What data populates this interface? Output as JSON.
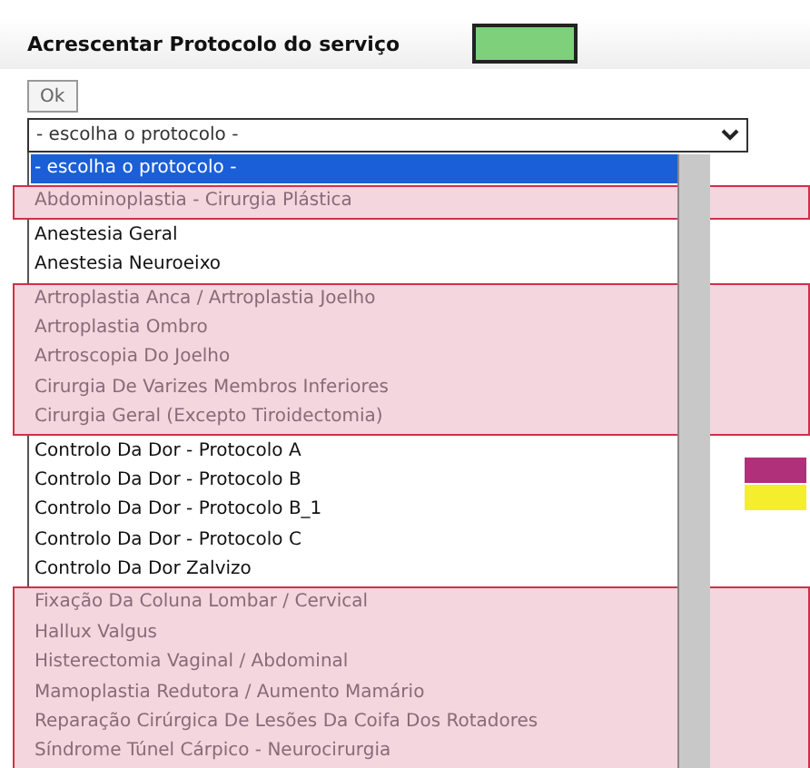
{
  "form": {
    "title": "Acrescentar Protocolo do serviço",
    "ok_button": "Ok",
    "select_value": "- escolha o protocolo -"
  },
  "options_groups": [
    {
      "highlighted": false,
      "options": [
        {
          "label": "- escolha o protocolo -",
          "selected": true
        }
      ]
    },
    {
      "highlighted": true,
      "options": [
        {
          "label": "Abdominoplastia - Cirurgia Plástica",
          "selected": false
        }
      ]
    },
    {
      "highlighted": false,
      "options": [
        {
          "label": "Anestesia Geral",
          "selected": false
        },
        {
          "label": "Anestesia Neuroeixo",
          "selected": false
        }
      ]
    },
    {
      "highlighted": true,
      "options": [
        {
          "label": "Artroplastia Anca / Artroplastia Joelho",
          "selected": false
        },
        {
          "label": "Artroplastia Ombro",
          "selected": false
        },
        {
          "label": "Artroscopia Do Joelho",
          "selected": false
        },
        {
          "label": "Cirurgia De Varizes Membros Inferiores",
          "selected": false
        },
        {
          "label": "Cirurgia Geral (Excepto Tiroidectomia)",
          "selected": false
        }
      ]
    },
    {
      "highlighted": false,
      "options": [
        {
          "label": "Controlo Da Dor - Protocolo A",
          "selected": false
        },
        {
          "label": "Controlo Da Dor - Protocolo B",
          "selected": false
        },
        {
          "label": "Controlo Da Dor - Protocolo B_1",
          "selected": false
        },
        {
          "label": "Controlo Da Dor - Protocolo C",
          "selected": false
        },
        {
          "label": "Controlo Da Dor Zalvizo",
          "selected": false
        }
      ]
    },
    {
      "highlighted": true,
      "options": [
        {
          "label": "Fixação Da Coluna Lombar / Cervical",
          "selected": false
        },
        {
          "label": "Hallux Valgus",
          "selected": false
        },
        {
          "label": "Histerectomia Vaginal / Abdominal",
          "selected": false
        },
        {
          "label": "Mamoplastia Redutora / Aumento Mamário",
          "selected": false
        },
        {
          "label": "Reparação Cirúrgica De Lesões Da Coifa Dos Rotadores",
          "selected": false
        },
        {
          "label": "Síndrome Túnel Cárpico - Neurocirurgia",
          "selected": false
        }
      ]
    }
  ],
  "side_swatches": [
    {
      "color": "#b0307a"
    },
    {
      "color": "#f4ee2c"
    }
  ]
}
